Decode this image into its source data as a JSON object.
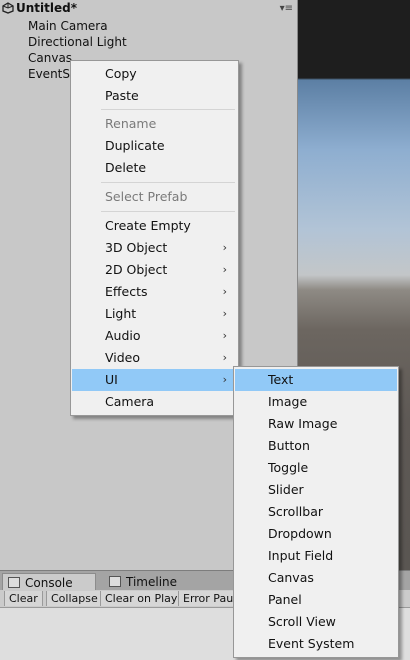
{
  "hierarchy": {
    "scene_title": "Untitled*",
    "items": [
      "Main Camera",
      "Directional Light",
      "Canvas",
      "EventS"
    ]
  },
  "console": {
    "tabs": [
      "Console",
      "Timeline"
    ],
    "toolbar": [
      "Clear",
      "Collapse",
      "Clear on Play",
      "Error Paus"
    ]
  },
  "context_menu": {
    "copy": "Copy",
    "paste": "Paste",
    "rename": "Rename",
    "duplicate": "Duplicate",
    "delete": "Delete",
    "select_prefab": "Select Prefab",
    "create_empty": "Create Empty",
    "obj3d": "3D Object",
    "obj2d": "2D Object",
    "effects": "Effects",
    "light": "Light",
    "audio": "Audio",
    "video": "Video",
    "ui": "UI",
    "camera": "Camera",
    "submenu_arrow": "›"
  },
  "ui_submenu": {
    "items": [
      "Text",
      "Image",
      "Raw Image",
      "Button",
      "Toggle",
      "Slider",
      "Scrollbar",
      "Dropdown",
      "Input Field",
      "Canvas",
      "Panel",
      "Scroll View",
      "Event System"
    ]
  },
  "colors": {
    "highlight": "#91c9f7",
    "menu_bg": "#f0f0f0"
  }
}
